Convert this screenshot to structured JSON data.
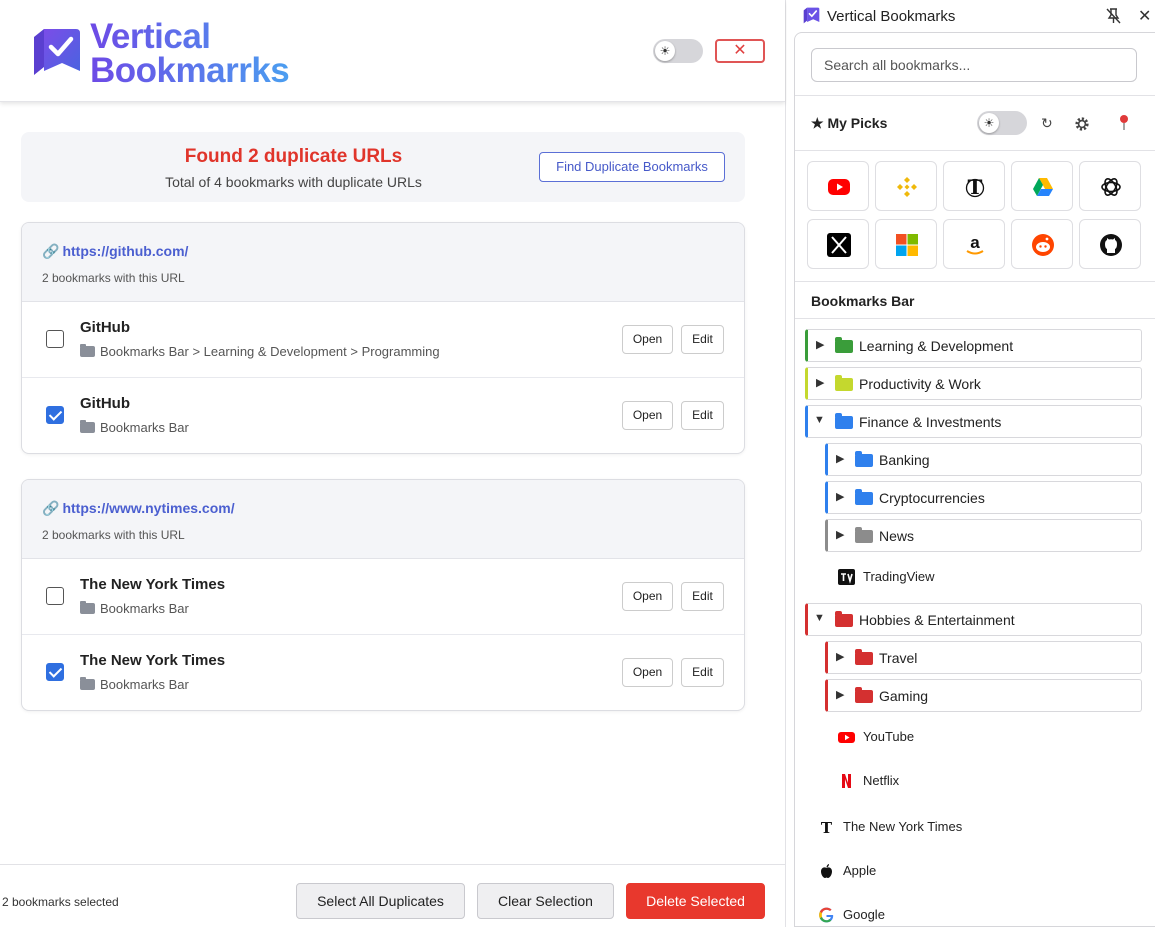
{
  "left": {
    "logo": {
      "line1": "Vertical",
      "line2": "Bookmarrks"
    },
    "summary": {
      "title": "Found 2 duplicate URLs",
      "subtitle": "Total of 4 bookmarks with duplicate URLs",
      "find_button": "Find Duplicate Bookmarks"
    },
    "groups": [
      {
        "url": "https://github.com/",
        "count": "2 bookmarks with this URL",
        "items": [
          {
            "title": "GitHub",
            "path": "Bookmarks Bar > Learning & Development > Programming",
            "checked": false
          },
          {
            "title": "GitHub",
            "path": "Bookmarks Bar",
            "checked": true
          }
        ]
      },
      {
        "url": "https://www.nytimes.com/",
        "count": "2 bookmarks with this URL",
        "items": [
          {
            "title": "The New York Times",
            "path": "Bookmarks Bar",
            "checked": false
          },
          {
            "title": "The New York Times",
            "path": "Bookmarks Bar",
            "checked": true
          }
        ]
      }
    ],
    "open_label": "Open",
    "edit_label": "Edit",
    "link_emoji": "🔗",
    "footer": {
      "selected_count": "2 bookmarks selected",
      "select_all": "Select All Duplicates",
      "clear": "Clear Selection",
      "delete": "Delete Selected"
    }
  },
  "right": {
    "title": "Vertical Bookmarks",
    "search": {
      "placeholder": "Search all bookmarks..."
    },
    "my_picks_label": "★ My Picks",
    "picks": [
      "youtube-icon",
      "binance-icon",
      "nytimes-icon",
      "google-drive-icon",
      "openai-icon",
      "x-icon",
      "microsoft-icon",
      "amazon-icon",
      "reddit-icon",
      "github-icon"
    ],
    "section_label": "Bookmarks Bar",
    "tree": {
      "learning": "Learning & Development",
      "productivity": "Productivity & Work",
      "finance": "Finance & Investments",
      "banking": "Banking",
      "crypto": "Cryptocurrencies",
      "news": "News",
      "tradingview": "TradingView",
      "hobbies": "Hobbies & Entertainment",
      "travel": "Travel",
      "gaming": "Gaming",
      "youtube": "YouTube",
      "netflix": "Netflix",
      "nyt": "The New York Times",
      "apple": "Apple",
      "google": "Google"
    }
  },
  "colors": {
    "accent_red": "#e8382d",
    "accent_blue": "#4b5fd0",
    "folder_green": "#3a9d3a",
    "folder_lime": "#c4d82e",
    "folder_blue": "#2f80ed",
    "folder_gray": "#8c8c8c",
    "folder_red": "#d43030"
  }
}
